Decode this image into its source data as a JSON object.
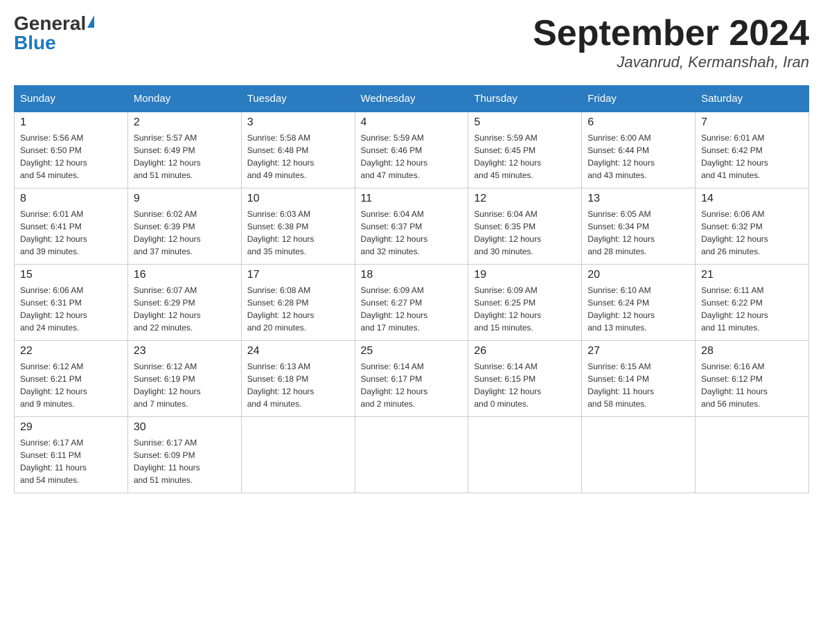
{
  "header": {
    "logo_general": "General",
    "logo_blue": "Blue",
    "title": "September 2024",
    "subtitle": "Javanrud, Kermanshah, Iran"
  },
  "days_header": [
    "Sunday",
    "Monday",
    "Tuesday",
    "Wednesday",
    "Thursday",
    "Friday",
    "Saturday"
  ],
  "weeks": [
    [
      {
        "num": "1",
        "sunrise": "5:56 AM",
        "sunset": "6:50 PM",
        "daylight": "12 hours and 54 minutes."
      },
      {
        "num": "2",
        "sunrise": "5:57 AM",
        "sunset": "6:49 PM",
        "daylight": "12 hours and 51 minutes."
      },
      {
        "num": "3",
        "sunrise": "5:58 AM",
        "sunset": "6:48 PM",
        "daylight": "12 hours and 49 minutes."
      },
      {
        "num": "4",
        "sunrise": "5:59 AM",
        "sunset": "6:46 PM",
        "daylight": "12 hours and 47 minutes."
      },
      {
        "num": "5",
        "sunrise": "5:59 AM",
        "sunset": "6:45 PM",
        "daylight": "12 hours and 45 minutes."
      },
      {
        "num": "6",
        "sunrise": "6:00 AM",
        "sunset": "6:44 PM",
        "daylight": "12 hours and 43 minutes."
      },
      {
        "num": "7",
        "sunrise": "6:01 AM",
        "sunset": "6:42 PM",
        "daylight": "12 hours and 41 minutes."
      }
    ],
    [
      {
        "num": "8",
        "sunrise": "6:01 AM",
        "sunset": "6:41 PM",
        "daylight": "12 hours and 39 minutes."
      },
      {
        "num": "9",
        "sunrise": "6:02 AM",
        "sunset": "6:39 PM",
        "daylight": "12 hours and 37 minutes."
      },
      {
        "num": "10",
        "sunrise": "6:03 AM",
        "sunset": "6:38 PM",
        "daylight": "12 hours and 35 minutes."
      },
      {
        "num": "11",
        "sunrise": "6:04 AM",
        "sunset": "6:37 PM",
        "daylight": "12 hours and 32 minutes."
      },
      {
        "num": "12",
        "sunrise": "6:04 AM",
        "sunset": "6:35 PM",
        "daylight": "12 hours and 30 minutes."
      },
      {
        "num": "13",
        "sunrise": "6:05 AM",
        "sunset": "6:34 PM",
        "daylight": "12 hours and 28 minutes."
      },
      {
        "num": "14",
        "sunrise": "6:06 AM",
        "sunset": "6:32 PM",
        "daylight": "12 hours and 26 minutes."
      }
    ],
    [
      {
        "num": "15",
        "sunrise": "6:06 AM",
        "sunset": "6:31 PM",
        "daylight": "12 hours and 24 minutes."
      },
      {
        "num": "16",
        "sunrise": "6:07 AM",
        "sunset": "6:29 PM",
        "daylight": "12 hours and 22 minutes."
      },
      {
        "num": "17",
        "sunrise": "6:08 AM",
        "sunset": "6:28 PM",
        "daylight": "12 hours and 20 minutes."
      },
      {
        "num": "18",
        "sunrise": "6:09 AM",
        "sunset": "6:27 PM",
        "daylight": "12 hours and 17 minutes."
      },
      {
        "num": "19",
        "sunrise": "6:09 AM",
        "sunset": "6:25 PM",
        "daylight": "12 hours and 15 minutes."
      },
      {
        "num": "20",
        "sunrise": "6:10 AM",
        "sunset": "6:24 PM",
        "daylight": "12 hours and 13 minutes."
      },
      {
        "num": "21",
        "sunrise": "6:11 AM",
        "sunset": "6:22 PM",
        "daylight": "12 hours and 11 minutes."
      }
    ],
    [
      {
        "num": "22",
        "sunrise": "6:12 AM",
        "sunset": "6:21 PM",
        "daylight": "12 hours and 9 minutes."
      },
      {
        "num": "23",
        "sunrise": "6:12 AM",
        "sunset": "6:19 PM",
        "daylight": "12 hours and 7 minutes."
      },
      {
        "num": "24",
        "sunrise": "6:13 AM",
        "sunset": "6:18 PM",
        "daylight": "12 hours and 4 minutes."
      },
      {
        "num": "25",
        "sunrise": "6:14 AM",
        "sunset": "6:17 PM",
        "daylight": "12 hours and 2 minutes."
      },
      {
        "num": "26",
        "sunrise": "6:14 AM",
        "sunset": "6:15 PM",
        "daylight": "12 hours and 0 minutes."
      },
      {
        "num": "27",
        "sunrise": "6:15 AM",
        "sunset": "6:14 PM",
        "daylight": "11 hours and 58 minutes."
      },
      {
        "num": "28",
        "sunrise": "6:16 AM",
        "sunset": "6:12 PM",
        "daylight": "11 hours and 56 minutes."
      }
    ],
    [
      {
        "num": "29",
        "sunrise": "6:17 AM",
        "sunset": "6:11 PM",
        "daylight": "11 hours and 54 minutes."
      },
      {
        "num": "30",
        "sunrise": "6:17 AM",
        "sunset": "6:09 PM",
        "daylight": "11 hours and 51 minutes."
      },
      {
        "num": "",
        "sunrise": "",
        "sunset": "",
        "daylight": ""
      },
      {
        "num": "",
        "sunrise": "",
        "sunset": "",
        "daylight": ""
      },
      {
        "num": "",
        "sunrise": "",
        "sunset": "",
        "daylight": ""
      },
      {
        "num": "",
        "sunrise": "",
        "sunset": "",
        "daylight": ""
      },
      {
        "num": "",
        "sunrise": "",
        "sunset": "",
        "daylight": ""
      }
    ]
  ],
  "labels": {
    "sunrise": "Sunrise:",
    "sunset": "Sunset:",
    "daylight": "Daylight:"
  }
}
